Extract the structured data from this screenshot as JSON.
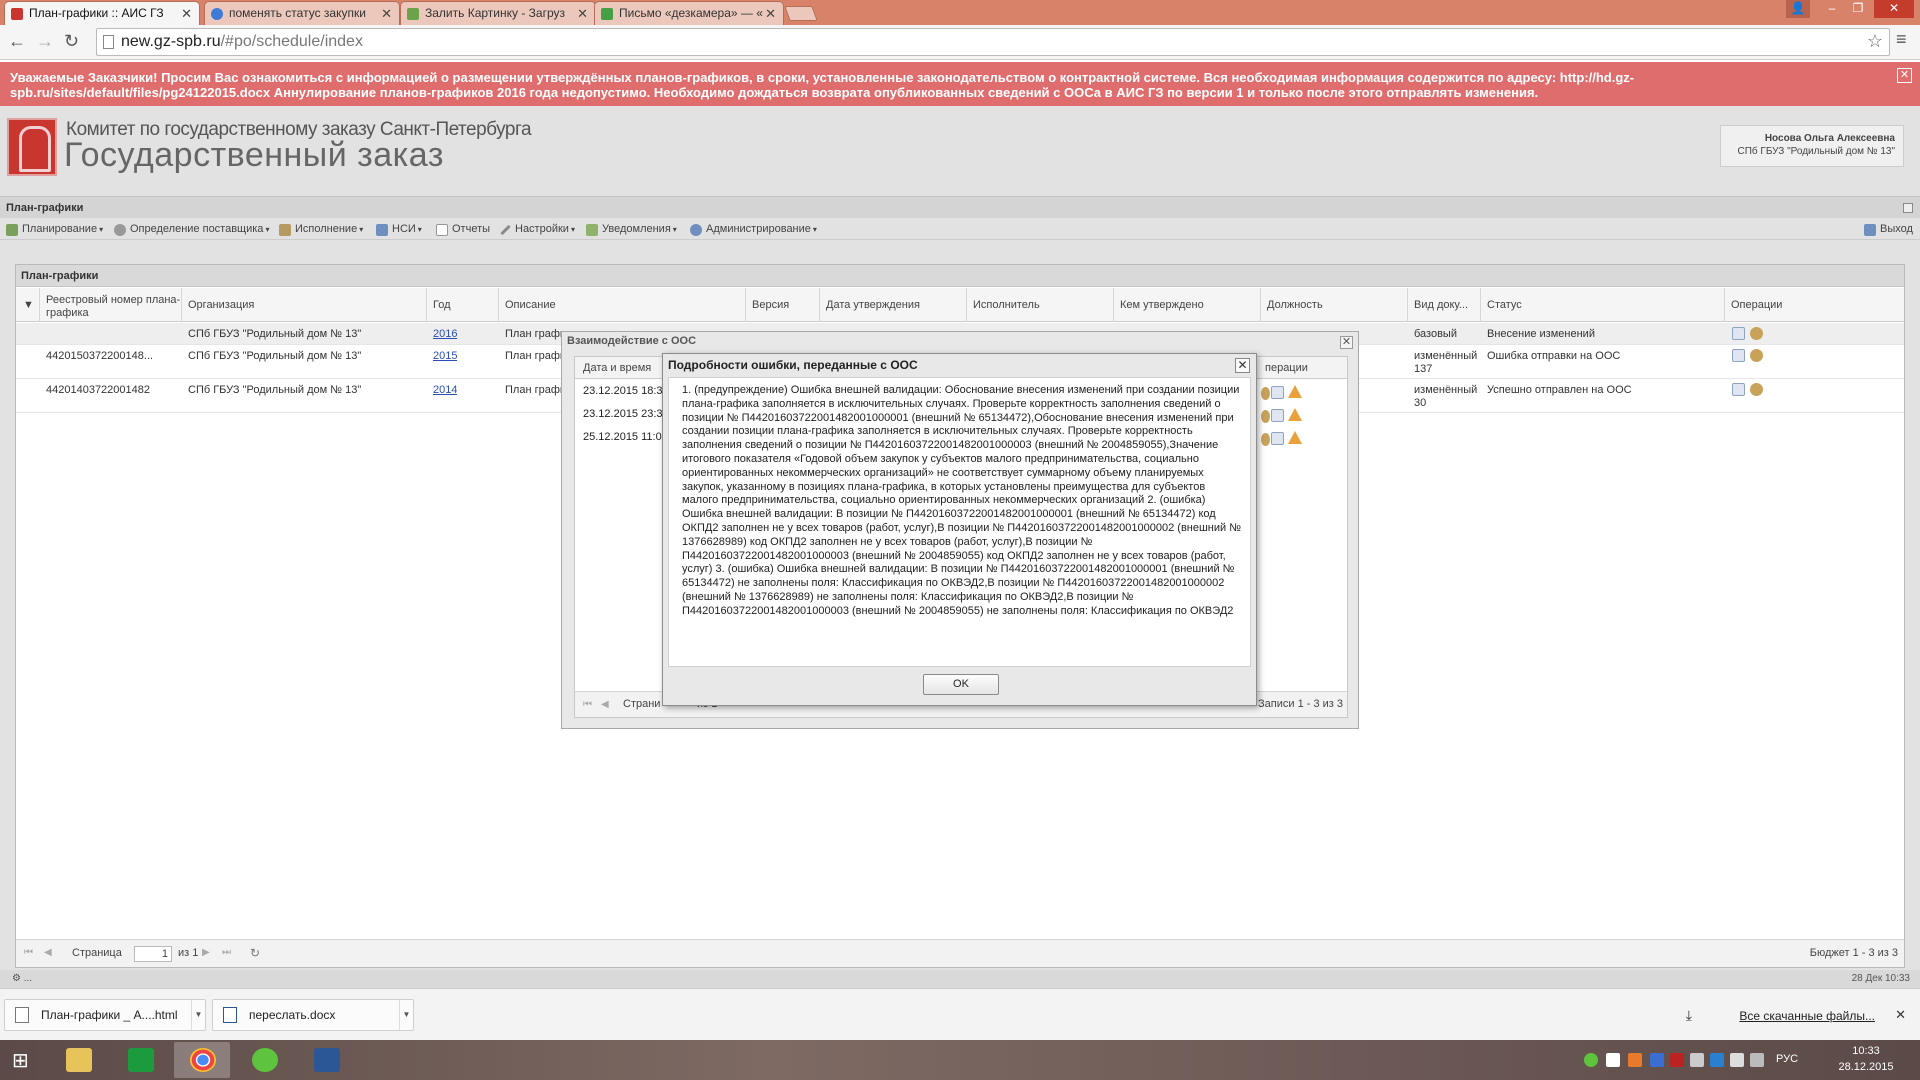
{
  "browser": {
    "tabs": [
      {
        "label": "План-графики :: АИС ГЗ",
        "active": true
      },
      {
        "label": "поменять статус закупки"
      },
      {
        "label": "Залить Картинку - Загруз"
      },
      {
        "label": "Письмо «дезкамера» — «"
      }
    ],
    "url_host": "new.gz-spb.ru",
    "url_path": "/#po/schedule/index"
  },
  "notice": {
    "text": "Уважаемые Заказчики! Просим Вас ознакомиться с информацией о размещении утверждённых планов-графиков, в сроки, установленные законодательством о контрактной системе. Вся необходимая информация содержится по адресу: http://hd.gz-spb.ru/sites/default/files/pg24122015.docx Аннулирование планов-графиков 2016 года недопустимо. Необходимо дождаться возврата опубликованных сведений с ООСа в АИС ГЗ по версии 1 и только после этого отправлять изменения."
  },
  "header": {
    "org_line1": "Комитет по государственному заказу Санкт-Петербурга",
    "org_line2": "Государственный заказ",
    "user_name": "Носова Ольга Алексеевна",
    "user_org": "СПб ГБУЗ \"Родильный дом № 13\""
  },
  "section_title": "План-графики",
  "menu": {
    "items": [
      "Планирование",
      "Определение поставщика",
      "Исполнение",
      "НСИ",
      "Отчеты",
      "Настройки",
      "Уведомления",
      "Администрирование"
    ],
    "logout": "Выход"
  },
  "grid": {
    "title": "План-графики",
    "columns": [
      "Реестровый номер плана-графика",
      "Организация",
      "Год",
      "Описание",
      "Версия",
      "Дата утверждения",
      "Исполнитель",
      "Кем утверждено",
      "Должность",
      "Вид доку...",
      "Статус",
      "Операции"
    ],
    "rows": [
      {
        "reg": "",
        "org": "СПб ГБУЗ \"Родильный дом № 13\"",
        "year": "2016",
        "desc": "План график",
        "kind": "базовый",
        "kind2": "",
        "status": "Внесение изменений"
      },
      {
        "reg": "4420150372200148...",
        "org": "СПб ГБУЗ \"Родильный дом № 13\"",
        "year": "2015",
        "desc": "План график",
        "kind": "изменённый",
        "kind2": "137",
        "status": "Ошибка отправки на ООС"
      },
      {
        "reg": "44201403722001482",
        "org": "СПб ГБУЗ \"Родильный дом № 13\"",
        "year": "2014",
        "desc": "План график",
        "kind": "изменённый",
        "kind2": "30",
        "status": "Успешно отправлен на ООС"
      }
    ],
    "pager": {
      "page_label": "Страница",
      "page": "1",
      "of": "из 1",
      "summary": "Бюджет 1 - 3 из 3"
    }
  },
  "dialog_interaction": {
    "title": "Взаимодействие с ООС",
    "columns": [
      "Дата и время",
      "перации"
    ],
    "rows": [
      "23.12.2015 18:3",
      "23.12.2015 23:3",
      "25.12.2015 11:0"
    ],
    "pager": {
      "page_label": "Страни",
      "of": "из 1",
      "summary": "Записи 1 - 3 из 3"
    }
  },
  "dialog_error": {
    "title": "Подробности ошибки, переданные с ООС",
    "body": "1. (предупреждение) Ошибка внешней валидации: Обоснование внесения изменений при создании позиции плана-графика заполняется в исключительных случаях. Проверьте корректность заполнения сведений о позиции № П44201603722001482001000001 (внешний № 65134472),Обоснование внесения изменений при создании позиции плана-графика заполняется в исключительных случаях. Проверьте корректность заполнения сведений о позиции № П44201603722001482001000003 (внешний № 2004859055),Значение итогового показателя «Годовой объем закупок у субъектов малого предпринимательства, социально ориентированных некоммерческих организаций» не соответствует суммарному объему планируемых закупок, указанному в позициях плана-графика, в которых установлены преимущества для субъектов малого предпринимательства, социально ориентированных некоммерческих организаций 2. (ошибка) Ошибка внешней валидации: В позиции № П44201603722001482001000001 (внешний № 65134472) код ОКПД2 заполнен не у всех товаров (работ, услуг),В позиции № П44201603722001482001000002 (внешний № 1376628989) код ОКПД2 заполнен не у всех товаров (работ, услуг),В позиции № П44201603722001482001000003 (внешний № 2004859055) код ОКПД2 заполнен не у всех товаров (работ, услуг) 3. (ошибка) Ошибка внешней валидации: В позиции № П44201603722001482001000001 (внешний № 65134472) не заполнены поля: Классификация по ОКВЭД2,В позиции № П44201603722001482001000002 (внешний № 1376628989) не заполнены поля: Классификация по ОКВЭД2,В позиции № П44201603722001482001000003 (внешний № 2004859055) не заполнены поля: Классификация по ОКВЭД2",
    "ok": "OK"
  },
  "statusbar": {
    "left": "⚙ ...",
    "right": "28 Дек 10:33"
  },
  "downloads": {
    "items": [
      "План-графики _ A....html",
      "переслать.docx"
    ],
    "all": "Все скачанные файлы..."
  },
  "taskbar": {
    "lang": "РУС",
    "time": "10:33",
    "date": "28.12.2015"
  },
  "colors": {
    "notice_bg": "#e06d6d",
    "tabbar": "#d9826a",
    "link": "#2a4fb2"
  }
}
